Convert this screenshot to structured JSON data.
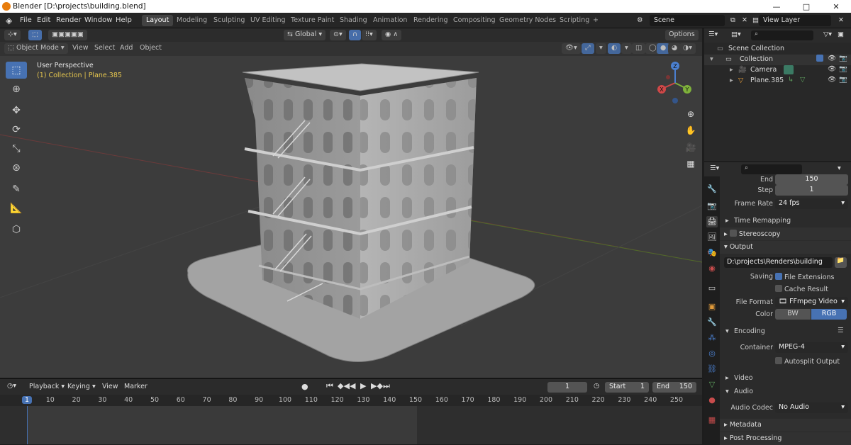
{
  "window": {
    "title": "Blender [D:\\projects\\building.blend]",
    "min": "—",
    "max": "□",
    "close": "✕"
  },
  "menu": [
    "File",
    "Edit",
    "Render",
    "Window",
    "Help"
  ],
  "workspaces": [
    "Layout",
    "Modeling",
    "Sculpting",
    "UV Editing",
    "Texture Paint",
    "Shading",
    "Animation",
    "Rendering",
    "Compositing",
    "Geometry Nodes",
    "Scripting"
  ],
  "scene": "Scene",
  "view_layer": "View Layer",
  "viewport": {
    "transform_orientation": "Global",
    "options": "Options",
    "mode": "Object Mode",
    "menus": [
      "View",
      "Select",
      "Add",
      "Object"
    ],
    "perspective": "User Perspective",
    "collection_info": "(1) Collection | Plane.385",
    "gizmo": {
      "x": "X",
      "y": "Y",
      "z": "Z"
    }
  },
  "timeline": {
    "menus": [
      "Playback",
      "Keying",
      "View",
      "Marker"
    ],
    "current_frame": "1",
    "start_label": "Start",
    "start": "1",
    "end_label": "End",
    "end": "150",
    "ticks": [
      "1",
      "10",
      "20",
      "30",
      "40",
      "50",
      "60",
      "70",
      "80",
      "90",
      "100",
      "110",
      "120",
      "130",
      "140",
      "150",
      "160",
      "170",
      "180",
      "190",
      "200",
      "210",
      "220",
      "230",
      "240",
      "250"
    ]
  },
  "outliner": {
    "scene_collection": "Scene Collection",
    "collection": "Collection",
    "items": [
      "Camera",
      "Plane.385"
    ]
  },
  "properties": {
    "end_label": "End",
    "end_value": "150",
    "step_label": "Step",
    "step_value": "1",
    "frame_rate_label": "Frame Rate",
    "frame_rate_value": "24 fps",
    "time_remapping": "Time Remapping",
    "stereoscopy": "Stereoscopy",
    "output": "Output",
    "output_path": "D:\\projects\\Renders\\building",
    "saving_label": "Saving",
    "file_extensions": "File Extensions",
    "cache_result": "Cache Result",
    "file_format_label": "File Format",
    "file_format_value": "FFmpeg Video",
    "color_label": "Color",
    "color_bw": "BW",
    "color_rgb": "RGB",
    "encoding": "Encoding",
    "container_label": "Container",
    "container_value": "MPEG-4",
    "autosplit": "Autosplit Output",
    "video": "Video",
    "audio": "Audio",
    "audio_codec_label": "Audio Codec",
    "audio_codec_value": "No Audio",
    "metadata": "Metadata",
    "post_processing": "Post Processing"
  },
  "colors": {
    "accent": "#4772b3",
    "viewport_bg": "#3c3c3c",
    "active_collection": "#e8c84f"
  }
}
